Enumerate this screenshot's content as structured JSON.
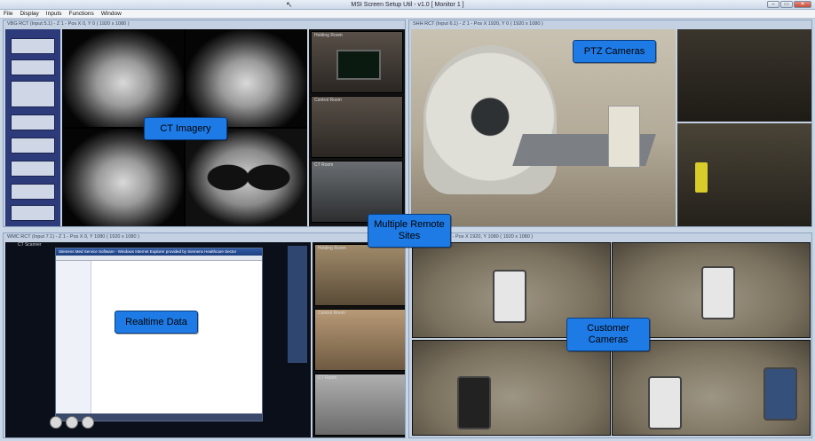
{
  "window": {
    "title": "MSI Screen Setup Util - v1.0  [ Monitor 1 ]",
    "controls": [
      "–",
      "▭",
      "✕"
    ]
  },
  "menu": [
    "File",
    "Display",
    "Inputs",
    "Functions",
    "Window"
  ],
  "quadrants": {
    "q1": {
      "label": "VBG RCT (Input 5.1) - Z 1 - Pos X 0, Y 0 ( 1920 x 1080 )",
      "rooms": [
        "Holding Room",
        "Control Room",
        "CT Room"
      ]
    },
    "q2": {
      "label": "SHH RCT (Input 6.1) - Z 1 - Pos X 1920, Y 0 ( 1920 x 1080 )"
    },
    "q3": {
      "label": "WMC RCT (Input 7.1) - Z 1 - Pos X 0, Y 1080 ( 1920 x 1080 )",
      "app_header": "CT Scanner",
      "window_title": "Siemens Med Service Software - Windows Internet Explorer provided by Siemens Healthcare Sector",
      "rooms": [
        "Holding Room",
        "Control Room",
        "CT Room"
      ]
    },
    "q4": {
      "label": "ill (Input 8.1) - Z 1 - Pos X 1920, Y 1080 ( 1920 x 1080 )"
    }
  },
  "callouts": {
    "ct_imagery": "CT Imagery",
    "ptz_cameras": "PTZ Cameras",
    "multiple_remote_sites": "Multiple Remote Sites",
    "realtime_data": "Realtime Data",
    "customer_cameras": "Customer Cameras"
  }
}
